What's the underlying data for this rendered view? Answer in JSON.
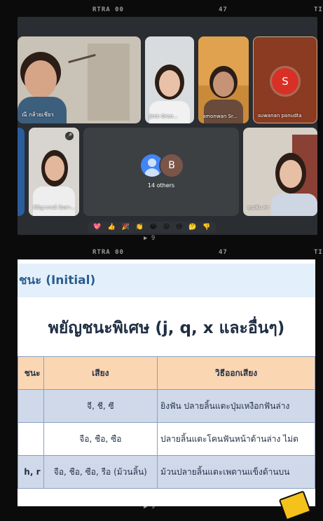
{
  "film": {
    "top_label": "RTRA 00",
    "top_number": "47",
    "top_right": "TI",
    "mid_frame": "▶ 9",
    "mid_label": "RTRA 00",
    "mid_number": "47",
    "mid_right": "TI",
    "bottom_frame": "▶ 9"
  },
  "meet": {
    "participants": [
      {
        "name": "ณี กล้วยเชียร"
      },
      {
        "name": "Jinin Oran..."
      },
      {
        "name": "amonwan Sr..."
      },
      {
        "name": "suwanan panudta",
        "initial": "S",
        "color": "#d93025"
      },
      {
        "name": ""
      },
      {
        "name": "ภิติญาภรณ์ จันทา..."
      },
      {
        "name": "คุณพิม ศร"
      }
    ],
    "others": {
      "initial_b": "B",
      "label": "14 others"
    },
    "reactions": [
      "💖",
      "👍",
      "🎉",
      "👏",
      "😂",
      "😮",
      "😢",
      "🤔",
      "👎"
    ]
  },
  "slide": {
    "header": "ชนะ (Initial)",
    "title": "พยัญชนะพิเศษ (j, q, x และอื่นๆ)",
    "table": {
      "headers": [
        "ชนะ",
        "เสียง",
        "วิธีออกเสียง"
      ],
      "rows": [
        [
          "",
          "จี, ชี, ซี",
          "ยิงฟัน ปลายลิ้นแตะปุ่มเหงือกฟันล่าง"
        ],
        [
          "",
          "จือ, ชือ, ซือ",
          "ปลายลิ้นแตะโคนฟันหน้าด้านล่าง ไม่ต"
        ],
        [
          "h, r",
          "จือ, ชือ, ซือ, รือ (ม้วนลิ้น)",
          "ม้วนปลายลิ้นแตะเพดานแข็งด้านบน"
        ]
      ]
    }
  }
}
